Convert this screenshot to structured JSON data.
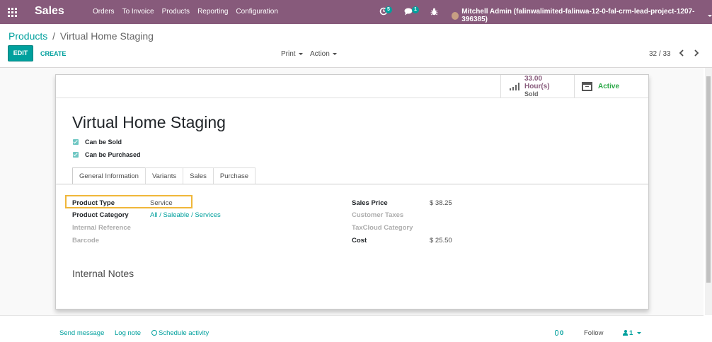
{
  "navbar": {
    "app_name": "Sales",
    "menu": [
      "Orders",
      "To Invoice",
      "Products",
      "Reporting",
      "Configuration"
    ],
    "activity_count": "5",
    "message_count": "1",
    "user_name": "Mitchell Admin (falinwalimited-falinwa-12-0-fal-crm-lead-project-1207-396385)",
    "bg_color": "#875a7b"
  },
  "breadcrumb": {
    "parent": "Products",
    "separator": "/",
    "current": "Virtual Home Staging"
  },
  "control_panel": {
    "edit_label": "EDIT",
    "create_label": "CREATE",
    "print_label": "Print",
    "action_label": "Action",
    "pager": "32 / 33",
    "accent_color": "#00a09d"
  },
  "smart_buttons": {
    "hours_value": "33.00 Hour(s)",
    "hours_label": "Sold",
    "active_label": "Active"
  },
  "product": {
    "name": "Virtual Home Staging",
    "can_be_sold_label": "Can be Sold",
    "can_be_sold": true,
    "can_be_purchased_label": "Can be Purchased",
    "can_be_purchased": true
  },
  "tabs": [
    "General Information",
    "Variants",
    "Sales",
    "Purchase"
  ],
  "general_info": {
    "left": [
      {
        "label": "Product Type",
        "value": "Service"
      },
      {
        "label": "Product Category",
        "value": "All / Saleable / Services"
      },
      {
        "label": "Internal Reference",
        "value": ""
      },
      {
        "label": "Barcode",
        "value": ""
      }
    ],
    "right": [
      {
        "label": "Sales Price",
        "value": "$ 38.25"
      },
      {
        "label": "Customer Taxes",
        "value": ""
      },
      {
        "label": "TaxCloud Category",
        "value": ""
      },
      {
        "label": "Cost",
        "value": "$ 25.50"
      }
    ]
  },
  "notes_title": "Internal Notes",
  "chatter": {
    "send_message": "Send message",
    "log_note": "Log note",
    "schedule_activity": "Schedule activity",
    "attachments": "0",
    "follow": "Follow",
    "followers": "1"
  }
}
